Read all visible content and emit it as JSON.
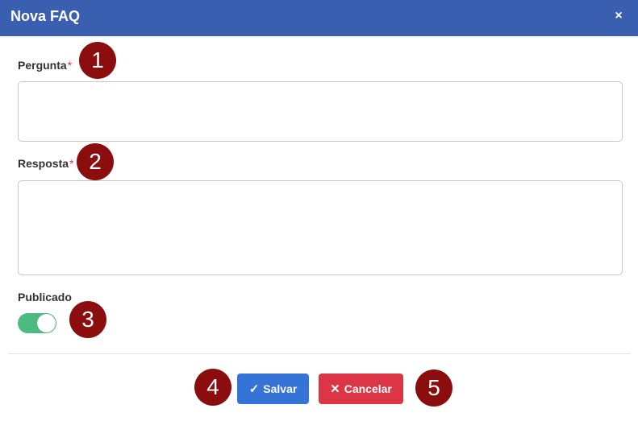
{
  "dialog": {
    "title": "Nova FAQ",
    "close_icon": "×"
  },
  "form": {
    "question": {
      "label": "Pergunta",
      "required_mark": "*",
      "value": ""
    },
    "answer": {
      "label": "Resposta",
      "required_mark": "*",
      "value": ""
    },
    "published": {
      "label": "Publicado",
      "checked": true
    }
  },
  "actions": {
    "save": {
      "icon": "✓",
      "label": "Salvar"
    },
    "cancel": {
      "icon": "✕",
      "label": "Cancelar"
    }
  },
  "annotations": [
    "1",
    "2",
    "3",
    "4",
    "5"
  ],
  "colors": {
    "header": "#3a5fb0",
    "save": "#3574d6",
    "cancel": "#dc3545",
    "toggle_on": "#4cbb7f",
    "badge": "#8b0d0d"
  }
}
